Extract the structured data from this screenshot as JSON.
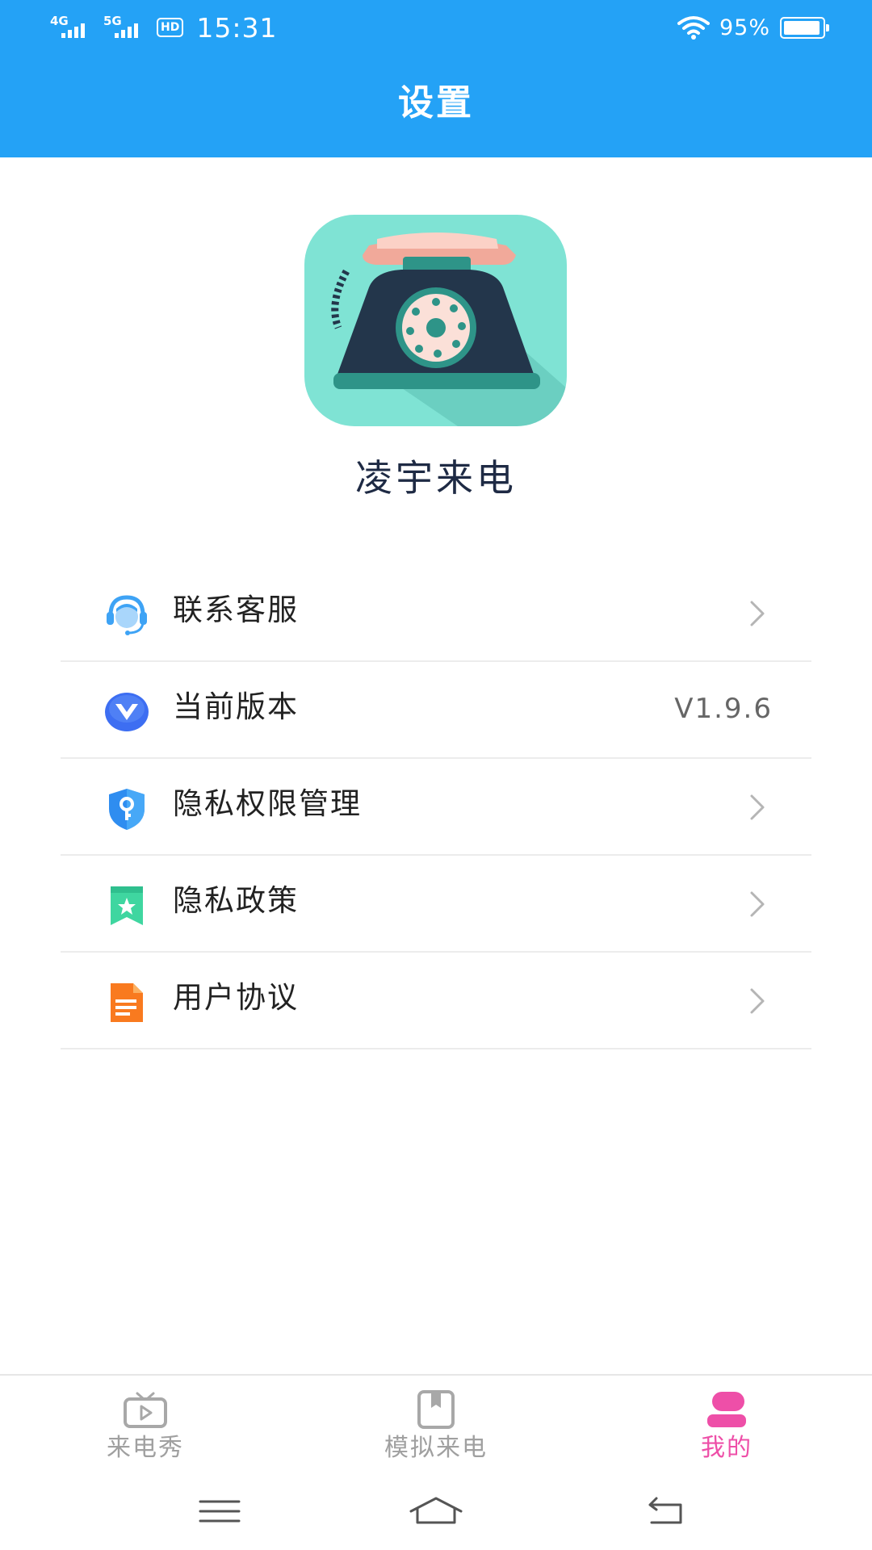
{
  "status_bar": {
    "net1": "4G",
    "net2": "5G",
    "hd_badge": "HD",
    "time": "15:31",
    "battery_text": "95%",
    "battery_level": 0.95,
    "icons": [
      "signal-icon",
      "signal-icon",
      "hd-icon",
      "wifi-icon",
      "battery-icon"
    ]
  },
  "header": {
    "title": "设置",
    "color": "#24a2f6"
  },
  "app": {
    "name": "凌宇来电",
    "logo_icon": "rotary-telephone-icon"
  },
  "menu": [
    {
      "label": "联系客服",
      "icon": "customer-service-icon",
      "trailing": "chevron"
    },
    {
      "label": "当前版本",
      "icon": "version-icon",
      "value": "V1.9.6"
    },
    {
      "label": "隐私权限管理",
      "icon": "privacy-shield-icon",
      "trailing": "chevron"
    },
    {
      "label": "隐私政策",
      "icon": "policy-bookmark-icon",
      "trailing": "chevron"
    },
    {
      "label": "用户协议",
      "icon": "document-icon",
      "trailing": "chevron"
    }
  ],
  "bottom_nav": [
    {
      "label": "来电秀",
      "icon": "tv-play-icon",
      "active": false
    },
    {
      "label": "模拟来电",
      "icon": "book-icon",
      "active": false
    },
    {
      "label": "我的",
      "icon": "profile-icon",
      "active": true
    }
  ],
  "colors": {
    "accent": "#24a2f6",
    "active_tab": "#ee4fa8",
    "inactive_tab": "#a0a0a0"
  },
  "system_nav": [
    "menu-icon",
    "home-icon",
    "back-icon"
  ]
}
